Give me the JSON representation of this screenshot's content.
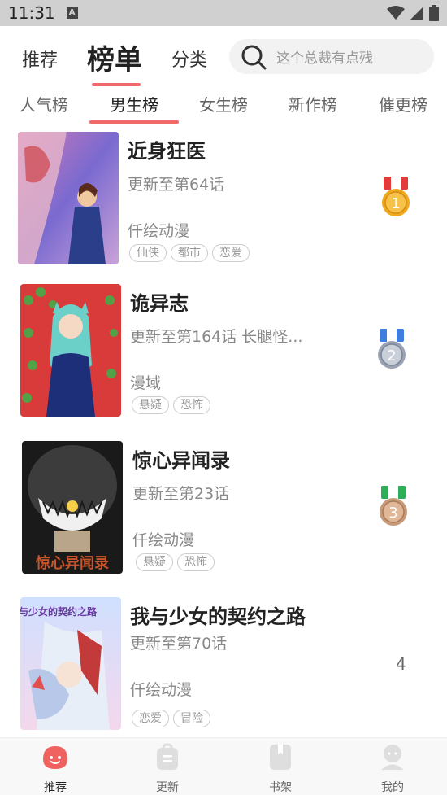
{
  "status": {
    "time": "11:31",
    "a_badge": "A"
  },
  "header": {
    "tabs": [
      {
        "label": "推荐"
      },
      {
        "label": "榜单"
      },
      {
        "label": "分类"
      }
    ],
    "search_placeholder": "这个总裁有点残"
  },
  "subtabs": [
    {
      "label": "人气榜"
    },
    {
      "label": "男生榜"
    },
    {
      "label": "女生榜"
    },
    {
      "label": "新作榜"
    },
    {
      "label": "催更榜"
    }
  ],
  "items": [
    {
      "title": "近身狂医",
      "chapter": "更新至第64话",
      "author": "仟绘动漫",
      "tags": [
        "仙侠",
        "都市",
        "恋爱"
      ],
      "rank": "1"
    },
    {
      "title": "诡异志",
      "chapter": "更新至第164话 长腿怪...",
      "author": "漫域",
      "tags": [
        "悬疑",
        "恐怖"
      ],
      "rank": "2"
    },
    {
      "title": "惊心异闻录",
      "chapter": "更新至第23话",
      "author": "仟绘动漫",
      "tags": [
        "悬疑",
        "恐怖"
      ],
      "rank": "3"
    },
    {
      "title": "我与少女的契约之路",
      "chapter": "更新至第70话",
      "author": "仟绘动漫",
      "tags": [
        "恋爱",
        "冒险"
      ],
      "rank": "4"
    }
  ],
  "covers": [
    {
      "text": ""
    },
    {
      "text": ""
    },
    {
      "text": "惊心异闻录"
    },
    {
      "text": "我与少女的契约之路"
    }
  ],
  "medal_colors": {
    "gold": "#f0a81e",
    "silver": "#9aa3b3",
    "bronze": "#c89a7a",
    "ribbon_red": "#e23b3b",
    "ribbon_blue": "#3d7ee0",
    "ribbon_green": "#2fae5a"
  },
  "accent_color": "#f06a6a",
  "bottom_nav": [
    {
      "label": "推荐",
      "icon": "recommend-face-icon"
    },
    {
      "label": "更新",
      "icon": "update-bag-icon"
    },
    {
      "label": "书架",
      "icon": "bookshelf-icon"
    },
    {
      "label": "我的",
      "icon": "profile-icon"
    }
  ]
}
